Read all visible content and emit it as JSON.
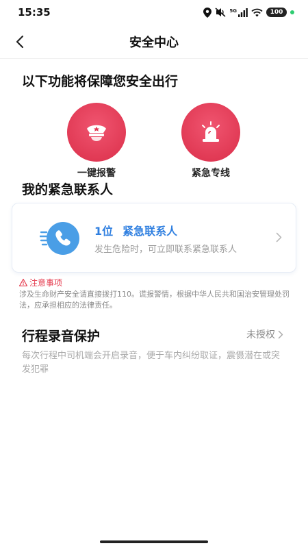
{
  "status_bar": {
    "time": "15:35",
    "network": "5G",
    "battery": "100",
    "icons": [
      "location-icon",
      "mute-icon",
      "signal-icon",
      "wifi-icon",
      "battery-icon"
    ]
  },
  "nav": {
    "title": "安全中心",
    "back_icon": "chevron-left-icon"
  },
  "features_section": {
    "title": "以下功能将保障您安全出行",
    "items": [
      {
        "label": "一键报警",
        "icon": "police-cap-icon"
      },
      {
        "label": "紧急专线",
        "icon": "siren-icon"
      }
    ]
  },
  "contacts_section": {
    "title": "我的紧急联系人",
    "card": {
      "count": "1位",
      "label": "紧急联系人",
      "description": "发生危险时，可立即联系紧急联系人",
      "icon": "phone-icon"
    }
  },
  "notice": {
    "title": "注意事项",
    "text": "涉及生命财产安全请直接拨打110。谎报警情，根据中华人民共和国治安管理处罚法，应承担相应的法律责任。"
  },
  "recording_section": {
    "title": "行程录音保护",
    "status": "未授权",
    "description": "每次行程中司机端会开启录音，便于车内纠纷取证，震慑潜在或突发犯罪"
  },
  "colors": {
    "accent_red": "#e13a55",
    "accent_blue": "#2f7fe0",
    "badge_blue": "#4a9ee6",
    "notice_red": "#e53b4e"
  }
}
